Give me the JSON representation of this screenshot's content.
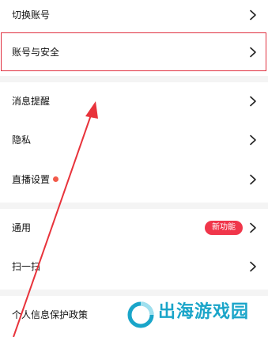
{
  "settings": {
    "items": [
      {
        "label": "切换账号"
      },
      {
        "label": "账号与安全"
      },
      {
        "label": "消息提醒"
      },
      {
        "label": "隐私"
      },
      {
        "label": "直播设置"
      },
      {
        "label": "通用",
        "badge": "新功能"
      },
      {
        "label": "扫一扫"
      },
      {
        "label": "个人信息保护政策"
      }
    ]
  },
  "watermark": {
    "text": "出海游戏园"
  },
  "colors": {
    "highlight_border": "#e0303f",
    "arrow": "#e8333b",
    "badge_bg": "#f0364a",
    "dot": "#f25a4a",
    "section_gap": "#f4f4f4",
    "watermark": "#1aa5c9"
  },
  "icons": {
    "chevron": "chevron-right-icon",
    "annotation": "red-arrow-annotation"
  }
}
